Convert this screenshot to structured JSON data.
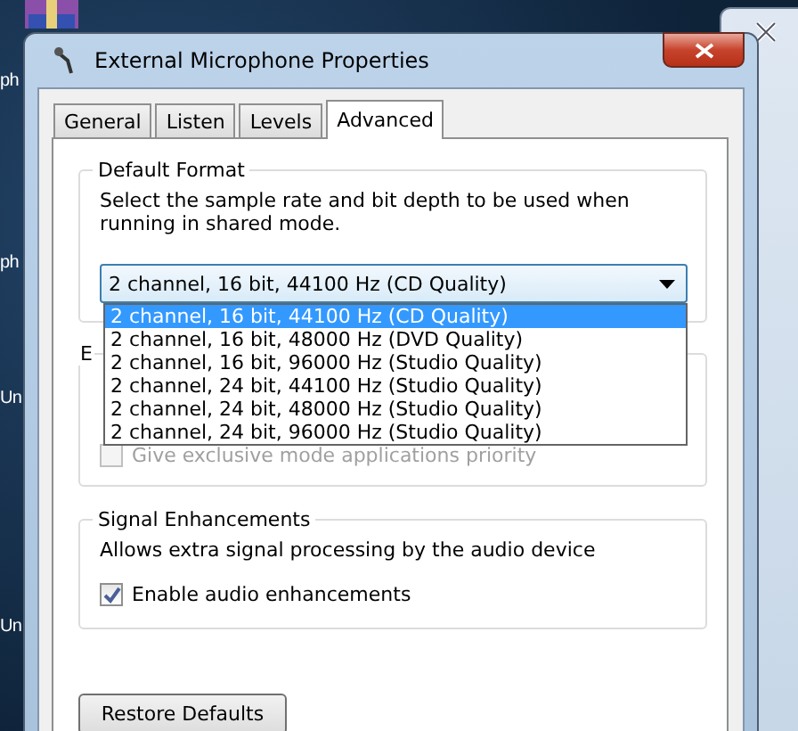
{
  "desktop_labels": [
    "ph",
    "ph",
    "Un",
    "Un"
  ],
  "window": {
    "title": "External Microphone Properties"
  },
  "tabs": [
    {
      "label": "General",
      "selected": false
    },
    {
      "label": "Listen",
      "selected": false
    },
    {
      "label": "Levels",
      "selected": false
    },
    {
      "label": "Advanced",
      "selected": true
    }
  ],
  "default_format": {
    "title": "Default Format",
    "description": "Select the sample rate and bit depth to be used when running in shared mode.",
    "value": "2 channel, 16 bit, 44100 Hz (CD Quality)",
    "expanded": true,
    "options": [
      {
        "label": "2 channel, 16 bit, 44100 Hz (CD Quality)",
        "selected": true
      },
      {
        "label": "2 channel, 16 bit, 48000 Hz (DVD Quality)",
        "selected": false
      },
      {
        "label": "2 channel, 16 bit, 96000 Hz (Studio Quality)",
        "selected": false
      },
      {
        "label": "2 channel, 24 bit, 44100 Hz (Studio Quality)",
        "selected": false
      },
      {
        "label": "2 channel, 24 bit, 48000 Hz (Studio Quality)",
        "selected": false
      },
      {
        "label": "2 channel, 24 bit, 96000 Hz (Studio Quality)",
        "selected": false
      }
    ]
  },
  "exclusive_mode": {
    "title": "E",
    "checkbox": {
      "label": "Give exclusive mode applications priority",
      "checked": false,
      "disabled": true
    }
  },
  "signal_enhancements": {
    "title": "Signal Enhancements",
    "description": "Allows extra signal processing by the audio device",
    "checkbox": {
      "label": "Enable audio enhancements",
      "checked": true,
      "disabled": false
    }
  },
  "buttons": [
    "Restore Defaults"
  ]
}
